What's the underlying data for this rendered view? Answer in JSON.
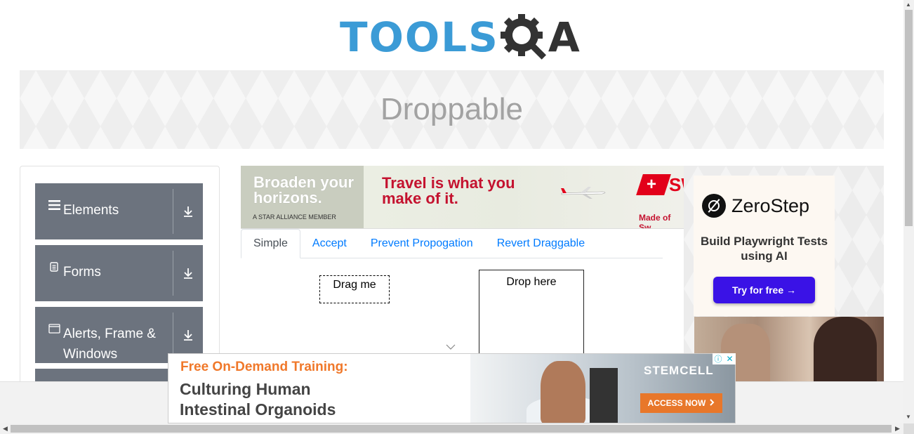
{
  "header": {
    "logo_text": "TOOLS",
    "logo_qa": "A"
  },
  "banner": {
    "title": "Droppable"
  },
  "sidebar": {
    "groups": [
      {
        "label": "Elements",
        "icon": "hamburger-icon"
      },
      {
        "label": "Forms",
        "icon": "document-icon"
      },
      {
        "label": "Alerts, Frame & Windows",
        "icon": "window-icon"
      }
    ]
  },
  "top_ad": {
    "left_text": "Broaden your horizons.",
    "alliance": "A STAR ALLIANCE MEMBER",
    "headline": "Travel is what you make of it.",
    "brand_partial": "SW",
    "tagline_partial": "Made of Sw"
  },
  "tabs": [
    {
      "label": "Simple",
      "active": true
    },
    {
      "label": "Accept",
      "active": false
    },
    {
      "label": "Prevent Propogation",
      "active": false
    },
    {
      "label": "Revert Draggable",
      "active": false
    }
  ],
  "simple": {
    "drag_label": "Drag me",
    "drop_label": "Drop here"
  },
  "right_ad": {
    "brand": "ZeroStep",
    "subtitle": "Build Playwright Tests using AI",
    "cta": "Try for free →"
  },
  "bottom_ad": {
    "kicker": "Free On-Demand Training:",
    "headline_1": "Culturing Human",
    "headline_2": "Intestinal Organoids",
    "brand": "STEMCELL",
    "cta": "ACCESS NOW",
    "close": "✕",
    "info": "ⓘ"
  },
  "colors": {
    "logo_blue": "#3b9bd6",
    "menu_bg": "#6c737e",
    "tab_link": "#007bff",
    "zerostep_button": "#3a12e6",
    "stemcell_orange": "#e8772a"
  }
}
